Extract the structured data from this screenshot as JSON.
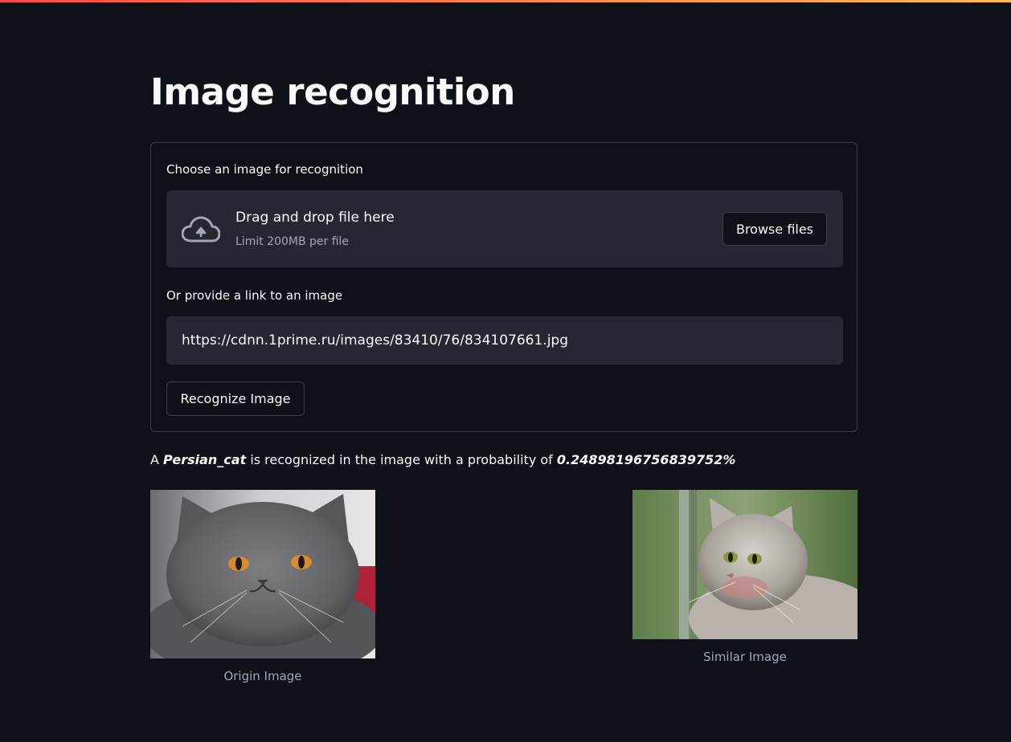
{
  "app": {
    "title": "Image recognition"
  },
  "uploader": {
    "label": "Choose an image for recognition",
    "drop_title": "Drag and drop file here",
    "drop_limit": "Limit 200MB per file",
    "browse_label": "Browse files",
    "icon": "cloud-upload-icon"
  },
  "link_input": {
    "label": "Or provide a link to an image",
    "value": "https://cdnn.1prime.ru/images/83410/76/834107661.jpg"
  },
  "recognize_button": {
    "label": "Recognize Image"
  },
  "result": {
    "prefix": "A",
    "class_name": "Persian_cat",
    "middle": "is recognized in the image with a probability of",
    "probability": "0.24898196756839752%"
  },
  "images": {
    "origin_caption": "Origin Image",
    "similar_caption": "Similar Image"
  },
  "colors": {
    "background": "#0e1117",
    "widget": "#262730",
    "text": "#fafafa",
    "muted": "#a3a8b8",
    "accent_start": "#ff4b4b",
    "accent_end": "#ffbd45"
  }
}
